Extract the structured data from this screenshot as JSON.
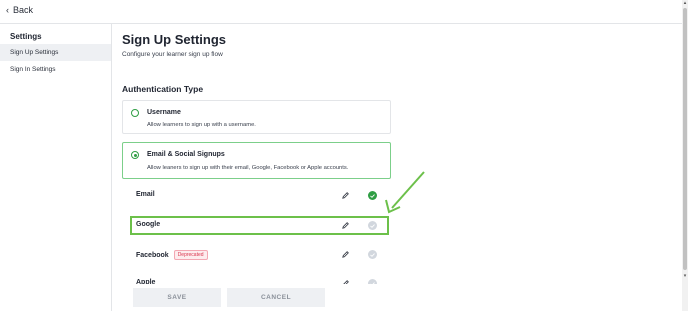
{
  "topbar": {
    "back_label": "Back"
  },
  "sidebar": {
    "title": "Settings",
    "items": [
      {
        "label": "Sign Up Settings",
        "active": true
      },
      {
        "label": "Sign In Settings",
        "active": false
      }
    ]
  },
  "main": {
    "title": "Sign Up Settings",
    "subtitle": "Configure your learner sign up flow",
    "section_title": "Authentication Type",
    "options": [
      {
        "title": "Username",
        "description": "Allow learners to sign up with a username.",
        "selected": false
      },
      {
        "title": "Email & Social Signups",
        "description": "Allow leaners to sign up with their email, Google, Facebook or Apple accounts.",
        "selected": true
      }
    ],
    "providers": [
      {
        "label": "Email",
        "badge": "",
        "enabled": true
      },
      {
        "label": "Google",
        "badge": "",
        "enabled": false
      },
      {
        "label": "Facebook",
        "badge": "Deprecated",
        "enabled": false
      },
      {
        "label": "Apple",
        "badge": "",
        "enabled": false
      }
    ]
  },
  "footer": {
    "save_label": "SAVE",
    "cancel_label": "CANCEL"
  },
  "annotation": {
    "color": "#6cc04a"
  },
  "colors": {
    "accent_green": "#2f9e44",
    "deprecated_red": "#d9364f"
  }
}
